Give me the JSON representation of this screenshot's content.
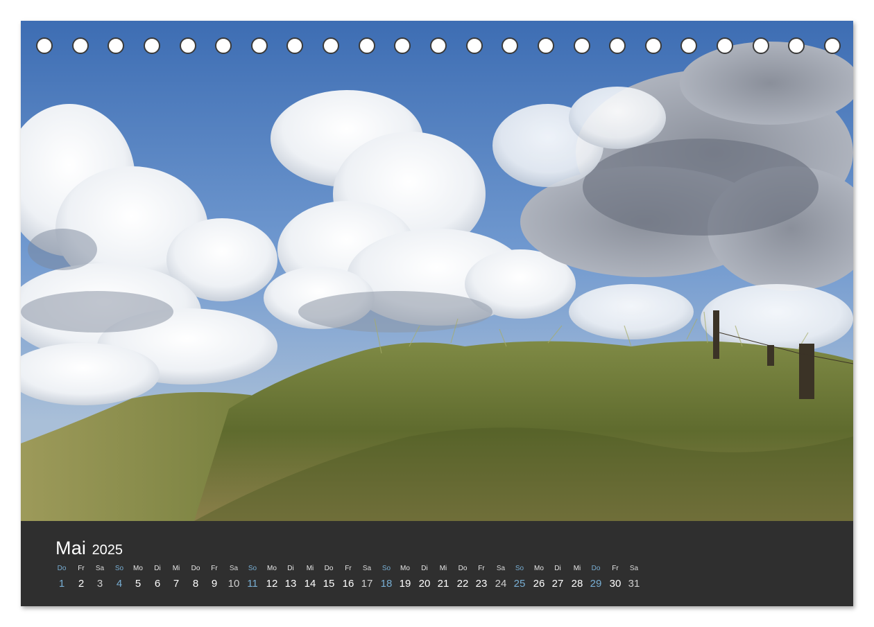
{
  "calendar": {
    "month": "Mai",
    "year": "2025",
    "days": [
      {
        "dow": "Do",
        "num": "1",
        "highlight": true
      },
      {
        "dow": "Fr",
        "num": "2"
      },
      {
        "dow": "Sa",
        "num": "3"
      },
      {
        "dow": "So",
        "num": "4",
        "highlight": true
      },
      {
        "dow": "Mo",
        "num": "5"
      },
      {
        "dow": "Di",
        "num": "6"
      },
      {
        "dow": "Mi",
        "num": "7"
      },
      {
        "dow": "Do",
        "num": "8"
      },
      {
        "dow": "Fr",
        "num": "9"
      },
      {
        "dow": "Sa",
        "num": "10"
      },
      {
        "dow": "So",
        "num": "11",
        "highlight": true
      },
      {
        "dow": "Mo",
        "num": "12"
      },
      {
        "dow": "Di",
        "num": "13"
      },
      {
        "dow": "Mi",
        "num": "14"
      },
      {
        "dow": "Do",
        "num": "15"
      },
      {
        "dow": "Fr",
        "num": "16"
      },
      {
        "dow": "Sa",
        "num": "17"
      },
      {
        "dow": "So",
        "num": "18",
        "highlight": true
      },
      {
        "dow": "Mo",
        "num": "19"
      },
      {
        "dow": "Di",
        "num": "20"
      },
      {
        "dow": "Mi",
        "num": "21"
      },
      {
        "dow": "Do",
        "num": "22"
      },
      {
        "dow": "Fr",
        "num": "23"
      },
      {
        "dow": "Sa",
        "num": "24"
      },
      {
        "dow": "So",
        "num": "25",
        "highlight": true
      },
      {
        "dow": "Mo",
        "num": "26"
      },
      {
        "dow": "Di",
        "num": "27"
      },
      {
        "dow": "Mi",
        "num": "28"
      },
      {
        "dow": "Do",
        "num": "29",
        "highlight": true
      },
      {
        "dow": "Fr",
        "num": "30"
      },
      {
        "dow": "Sa",
        "num": "31"
      }
    ]
  },
  "binding": {
    "hole_count": 23
  },
  "colors": {
    "band": "#2f2f2f",
    "highlight": "#78aed3",
    "sky": "#4a78b8",
    "grass": "#6b7a36"
  },
  "photo": {
    "subject": "sand dunes with marram grass and wooden fence posts under a cloudy blue sky"
  }
}
